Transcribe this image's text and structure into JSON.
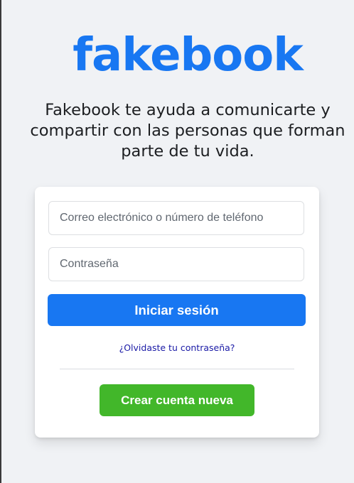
{
  "brand": {
    "logo_text": "fakebook",
    "tagline": "Fakebook te ayuda a comunicarte y\ncompartir con las personas que forman\nparte de tu vida.",
    "accent_color": "#1877f2",
    "create_color": "#42b72a"
  },
  "login": {
    "email_placeholder": "Correo electrónico o número de teléfono",
    "email_value": "",
    "password_placeholder": "Contraseña",
    "password_value": "",
    "login_label": "Iniciar sesión",
    "forgot_label": "¿Olvidaste tu contraseña?",
    "create_label": "Crear cuenta nueva"
  }
}
